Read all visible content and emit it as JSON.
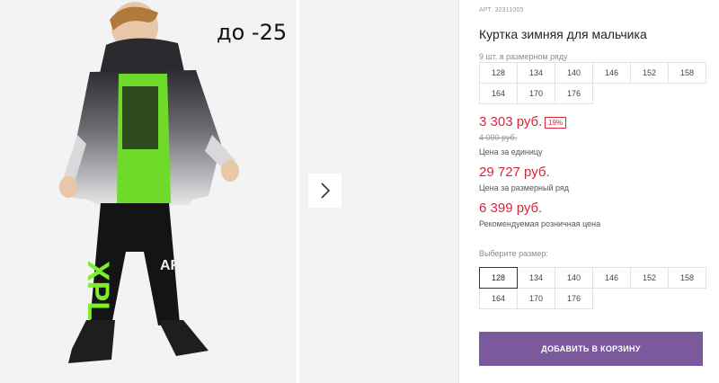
{
  "gallery": {
    "sale_badge": "до -25",
    "next_icon": "chevron-right-icon"
  },
  "product": {
    "article_prefix": "АРТ.",
    "article": "32311005",
    "title": "Куртка зимняя для мальчика",
    "pack_label": "9 шт. в размерном ряду",
    "pack_sizes": [
      "128",
      "134",
      "140",
      "146",
      "152",
      "158",
      "164",
      "170",
      "176"
    ],
    "price": "3 303 руб.",
    "discount": "19%",
    "old_price": "4 090 руб.",
    "price_unit_label": "Цена за единицу",
    "pack_price": "29 727 руб.",
    "pack_price_label": "Цена за размерный ряд",
    "rrp": "6 399 руб.",
    "rrp_label": "Рекомендуемая розничная цена",
    "choose_size_label": "Выберите размер:",
    "sizes": [
      "128",
      "134",
      "140",
      "146",
      "152",
      "158",
      "164",
      "170",
      "176"
    ],
    "selected_size": "128",
    "add_to_cart": "ДОБАВИТЬ В КОРЗИНУ"
  },
  "colors": {
    "price_red": "#d6263c",
    "button_purple": "#7a5a9d"
  }
}
